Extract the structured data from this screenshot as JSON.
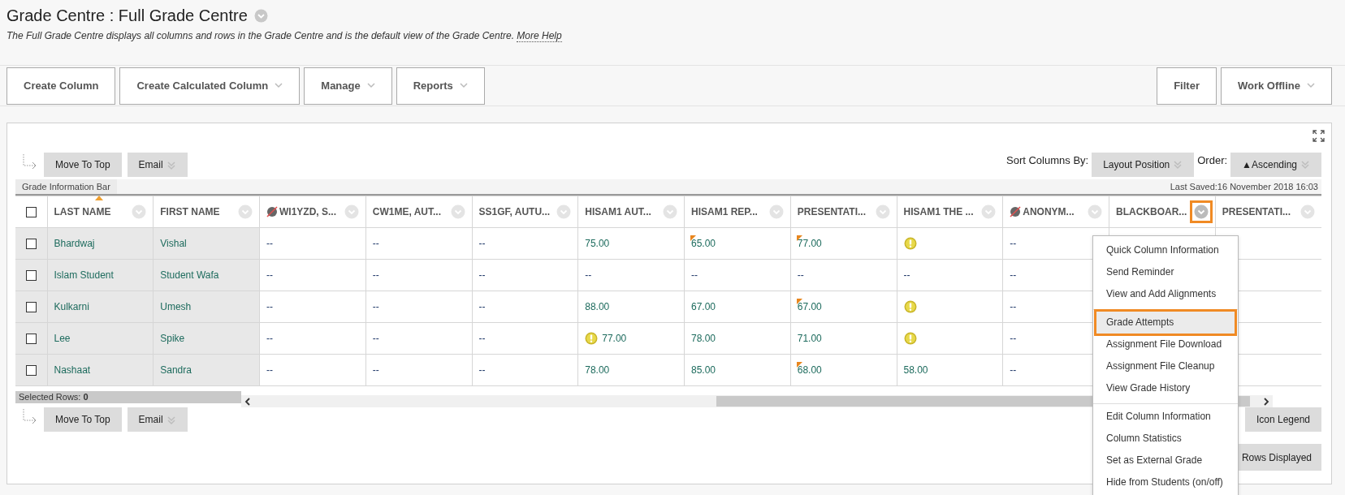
{
  "page": {
    "title": "Grade Centre : Full Grade Centre",
    "description": "The Full Grade Centre displays all columns and rows in the Grade Centre and is the default view of the Grade Centre.",
    "help_link": "More Help"
  },
  "toolbar": {
    "left": [
      {
        "label": "Create Column",
        "has_menu": false
      },
      {
        "label": "Create Calculated Column",
        "has_menu": true
      },
      {
        "label": "Manage",
        "has_menu": true
      },
      {
        "label": "Reports",
        "has_menu": true
      }
    ],
    "right": [
      {
        "label": "Filter",
        "has_menu": false
      },
      {
        "label": "Work Offline",
        "has_menu": true
      }
    ]
  },
  "actions_top": {
    "move_to_top": "Move To Top",
    "email": "Email"
  },
  "sort": {
    "label": "Sort Columns By:",
    "value": "Layout Position",
    "order_label": "Order:",
    "order_value": "▲Ascending"
  },
  "info_bar": {
    "label": "Grade Information Bar",
    "last_saved": "Last Saved:16 November 2018 16:03"
  },
  "table": {
    "select_all_checked": false,
    "columns": [
      {
        "label": "LAST NAME",
        "kind": "plain",
        "sorted": true,
        "selected": false
      },
      {
        "label": "FIRST NAME",
        "kind": "plain",
        "sorted": false,
        "selected": false
      },
      {
        "label": "WI1YZD, S...",
        "kind": "hidden",
        "sorted": false,
        "selected": false
      },
      {
        "label": "CW1ME, AUT...",
        "kind": "plain",
        "sorted": false,
        "selected": false
      },
      {
        "label": "SS1GF, AUTU...",
        "kind": "plain",
        "sorted": false,
        "selected": false
      },
      {
        "label": "HISAM1 AUT...",
        "kind": "plain",
        "sorted": false,
        "selected": false
      },
      {
        "label": "HISAM1 REP...",
        "kind": "plain",
        "sorted": false,
        "selected": false
      },
      {
        "label": "PRESENTATI...",
        "kind": "plain",
        "sorted": false,
        "selected": false
      },
      {
        "label": "HISAM1 THE ...",
        "kind": "plain",
        "sorted": false,
        "selected": false
      },
      {
        "label": "ANONYM...",
        "kind": "hidden",
        "sorted": false,
        "selected": false
      },
      {
        "label": "BLACKBOAR...",
        "kind": "plain",
        "sorted": false,
        "selected": true
      },
      {
        "label": "PRESENTATI...",
        "kind": "plain",
        "sorted": false,
        "selected": false
      }
    ],
    "rows": [
      {
        "checked": false,
        "cells": [
          {
            "kind": "name",
            "value": "Bhardwaj"
          },
          {
            "kind": "name",
            "value": "Vishal"
          },
          {
            "kind": "empty",
            "value": "--"
          },
          {
            "kind": "empty",
            "value": "--"
          },
          {
            "kind": "empty",
            "value": "--"
          },
          {
            "kind": "grade",
            "value": "75.00"
          },
          {
            "kind": "flagged",
            "value": "65.00"
          },
          {
            "kind": "flagged",
            "value": "77.00"
          },
          {
            "kind": "needs-grading"
          },
          {
            "kind": "empty",
            "value": "--"
          },
          {
            "kind": "blank"
          },
          {
            "kind": "blank"
          }
        ]
      },
      {
        "checked": false,
        "cells": [
          {
            "kind": "name",
            "value": "Islam Student"
          },
          {
            "kind": "name",
            "value": "Student Wafa"
          },
          {
            "kind": "empty",
            "value": "--"
          },
          {
            "kind": "empty",
            "value": "--"
          },
          {
            "kind": "empty",
            "value": "--"
          },
          {
            "kind": "empty",
            "value": "--"
          },
          {
            "kind": "empty",
            "value": "--"
          },
          {
            "kind": "empty",
            "value": "--"
          },
          {
            "kind": "empty",
            "value": "--"
          },
          {
            "kind": "empty",
            "value": "--"
          },
          {
            "kind": "blank"
          },
          {
            "kind": "blank"
          }
        ]
      },
      {
        "checked": false,
        "cells": [
          {
            "kind": "name",
            "value": "Kulkarni"
          },
          {
            "kind": "name",
            "value": "Umesh"
          },
          {
            "kind": "empty",
            "value": "--"
          },
          {
            "kind": "empty",
            "value": "--"
          },
          {
            "kind": "empty",
            "value": "--"
          },
          {
            "kind": "grade",
            "value": "88.00"
          },
          {
            "kind": "grade",
            "value": "67.00"
          },
          {
            "kind": "flagged",
            "value": "67.00"
          },
          {
            "kind": "needs-grading"
          },
          {
            "kind": "empty",
            "value": "--"
          },
          {
            "kind": "blank"
          },
          {
            "kind": "blank"
          }
        ]
      },
      {
        "checked": false,
        "cells": [
          {
            "kind": "name",
            "value": "Lee"
          },
          {
            "kind": "name",
            "value": "Spike"
          },
          {
            "kind": "empty",
            "value": "--"
          },
          {
            "kind": "empty",
            "value": "--"
          },
          {
            "kind": "empty",
            "value": "--"
          },
          {
            "kind": "needs-grading",
            "value": "77.00"
          },
          {
            "kind": "grade",
            "value": "78.00"
          },
          {
            "kind": "grade",
            "value": "71.00"
          },
          {
            "kind": "needs-grading"
          },
          {
            "kind": "empty",
            "value": "--"
          },
          {
            "kind": "blank"
          },
          {
            "kind": "blank"
          }
        ]
      },
      {
        "checked": false,
        "cells": [
          {
            "kind": "name",
            "value": "Nashaat"
          },
          {
            "kind": "name",
            "value": "Sandra"
          },
          {
            "kind": "empty",
            "value": "--"
          },
          {
            "kind": "empty",
            "value": "--"
          },
          {
            "kind": "empty",
            "value": "--"
          },
          {
            "kind": "grade",
            "value": "78.00"
          },
          {
            "kind": "grade",
            "value": "85.00"
          },
          {
            "kind": "flagged",
            "value": "68.00"
          },
          {
            "kind": "grade",
            "value": "58.00"
          },
          {
            "kind": "empty",
            "value": "--"
          },
          {
            "kind": "blank"
          },
          {
            "kind": "blank"
          }
        ]
      }
    ],
    "selected_rows_label": "Selected Rows:",
    "selected_rows_count": "0"
  },
  "actions_bottom": {
    "move_to_top": "Move To Top",
    "email": "Email"
  },
  "bottom": {
    "icon_legend": "Icon Legend",
    "rows_displayed": "Rows Displayed"
  },
  "column_menu": {
    "groups": [
      [
        {
          "label": "Quick Column Information",
          "selected": false
        },
        {
          "label": "Send Reminder",
          "selected": false
        },
        {
          "label": "View and Add Alignments",
          "selected": false
        }
      ],
      [
        {
          "label": "Grade Attempts",
          "selected": true
        },
        {
          "label": "Assignment File Download",
          "selected": false
        },
        {
          "label": "Assignment File Cleanup",
          "selected": false
        },
        {
          "label": "View Grade History",
          "selected": false
        }
      ],
      [
        {
          "label": "Edit Column Information",
          "selected": false
        },
        {
          "label": "Column Statistics",
          "selected": false
        },
        {
          "label": "Set as External Grade",
          "selected": false
        },
        {
          "label": "Hide from Students (on/off)",
          "selected": false
        }
      ]
    ]
  }
}
